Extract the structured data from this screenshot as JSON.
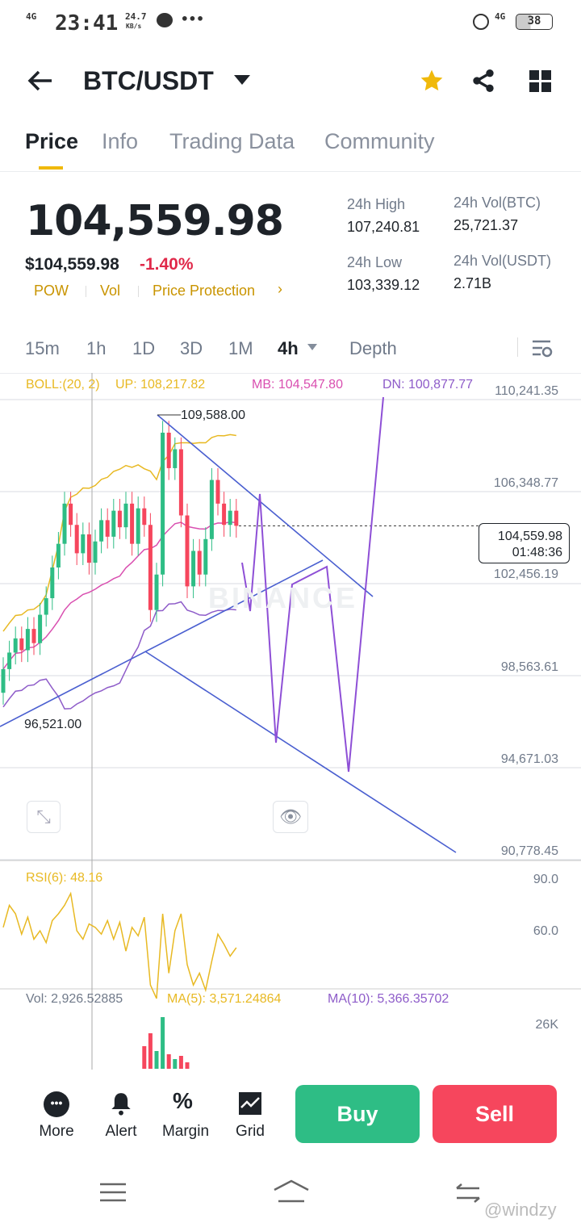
{
  "status": {
    "network": "4G",
    "time": "23:41",
    "speed": "24.7",
    "speed_unit": "KB/s",
    "more": "•••",
    "network_right": "4G",
    "battery": "38"
  },
  "header": {
    "title": "BTC/USDT"
  },
  "tabs": [
    {
      "label": "Price"
    },
    {
      "label": "Info"
    },
    {
      "label": "Trading Data"
    },
    {
      "label": "Community"
    }
  ],
  "price": {
    "last": "104,559.98",
    "usd": "$104,559.98",
    "change": "-1.40%",
    "tags": [
      "POW",
      "Vol",
      "Price Protection"
    ],
    "stats": {
      "high_label": "24h High",
      "high": "107,240.81",
      "low_label": "24h Low",
      "low": "103,339.12",
      "volbtc_label": "24h Vol(BTC)",
      "volbtc": "25,721.37",
      "volusdt_label": "24h Vol(USDT)",
      "volusdt": "2.71B"
    }
  },
  "intervals": [
    "15m",
    "1h",
    "1D",
    "3D",
    "1M",
    "4h",
    "Depth"
  ],
  "chart": {
    "boll": "BOLL:(20, 2)",
    "up": "UP: 108,217.82",
    "mb": "MB: 104,547.80",
    "dn": "DN: 100,877.77",
    "axis": [
      "110,241.35",
      "106,348.77",
      "102,456.19",
      "98,563.61",
      "94,671.03",
      "90,778.45"
    ],
    "high_mark": "109,588.00",
    "low_mark": "96,521.00",
    "current": "104,559.98",
    "countdown": "01:48:36",
    "watermark": "BINANCE",
    "closes": [
      98.5,
      99.2,
      99.8,
      99.3,
      100.2,
      99.6,
      100.8,
      101.5,
      102.8,
      103.8,
      105.5,
      104.6,
      103.4,
      104.2,
      103.0,
      103.9,
      104.8,
      104.1,
      105.2,
      104.5,
      105.5,
      103.8,
      105.3,
      104.6,
      101.0,
      102.5,
      108.5,
      107.0,
      107.8,
      105.0,
      102.0,
      103.5,
      102.5,
      104.0,
      106.5,
      105.5,
      104.6,
      105.2,
      104.56
    ],
    "rsi_label": "RSI(6): 48.16",
    "rsi_axis": [
      "90.0",
      "60.0"
    ],
    "rsi": [
      62,
      75,
      70,
      58,
      68,
      55,
      60,
      53,
      66,
      70,
      75,
      82,
      60,
      55,
      64,
      62,
      58,
      66,
      55,
      65,
      48,
      62,
      57,
      68,
      28,
      20,
      70,
      35,
      60,
      70,
      40,
      28,
      35,
      25,
      42,
      58,
      52,
      45,
      50
    ],
    "vol_label": "Vol: 2,926.52885",
    "ma5": "MA(5): 3,571.24864",
    "ma10": "MA(10): 5,366.35702",
    "vol_axis": "26K"
  },
  "bottom": {
    "more": "More",
    "alert": "Alert",
    "margin": "Margin",
    "grid": "Grid",
    "buy": "Buy",
    "sell": "Sell"
  },
  "watermark": "@windzy",
  "colors": {
    "up": "#2ebd85",
    "down": "#f6465d",
    "accent": "#f0b90b",
    "boll_up": "#e8b923",
    "boll_mb": "#d94fb0",
    "boll_dn": "#8e5cc9"
  }
}
